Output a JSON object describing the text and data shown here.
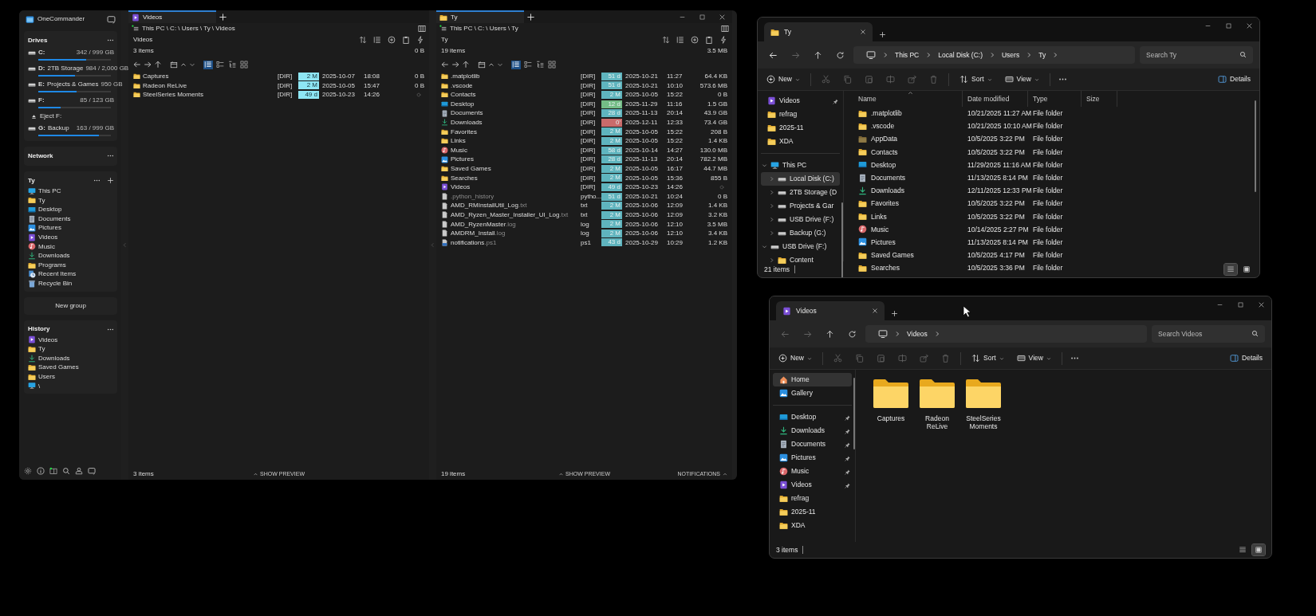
{
  "onecommander": {
    "title": "OneCommander",
    "drives": {
      "heading": "Drives",
      "items": [
        {
          "kind": "drive",
          "letter": "C:",
          "usage": "342 / 999 GB",
          "level": 0.66
        },
        {
          "kind": "drive",
          "letter": "D:",
          "label": "2TB Storage",
          "usage": "984 / 2,000 GB",
          "level": 0.51
        },
        {
          "kind": "drive",
          "letter": "E:",
          "label": "Projects & Games",
          "usage": "950 GB",
          "level": 0.53
        },
        {
          "kind": "drive",
          "letter": "F:",
          "usage": "85 / 123 GB",
          "level": 0.31
        },
        {
          "kind": "eject",
          "label": "Eject F:"
        },
        {
          "kind": "drive",
          "letter": "G:",
          "label": "Backup",
          "usage": "163 / 999 GB",
          "level": 0.84
        }
      ]
    },
    "network": {
      "heading": "Network"
    },
    "group": {
      "heading": "Ty",
      "items": [
        {
          "kind": "pc",
          "label": "This PC"
        },
        {
          "kind": "folder",
          "label": "Ty"
        },
        {
          "kind": "desktop",
          "label": "Desktop"
        },
        {
          "kind": "documents",
          "label": "Documents"
        },
        {
          "kind": "pictures",
          "label": "Pictures"
        },
        {
          "kind": "videos",
          "label": "Videos"
        },
        {
          "kind": "music",
          "label": "Music"
        },
        {
          "kind": "downloads",
          "label": "Downloads"
        },
        {
          "kind": "folder",
          "label": "Programs"
        },
        {
          "kind": "recent",
          "label": "Recent Items"
        },
        {
          "kind": "recycle",
          "label": "Recycle Bin"
        }
      ]
    },
    "new_group": "New group",
    "history": {
      "heading": "History",
      "items": [
        {
          "kind": "videos",
          "label": "Videos"
        },
        {
          "kind": "folder",
          "label": "Ty"
        },
        {
          "kind": "downloads",
          "label": "Downloads"
        },
        {
          "kind": "folder",
          "label": "Saved Games"
        },
        {
          "kind": "folder",
          "label": "Users"
        },
        {
          "kind": "pc",
          "label": "\\"
        }
      ]
    },
    "panes": [
      {
        "tab": {
          "kind": "videos",
          "label": "Videos"
        },
        "path": "This PC  \\ C: \\ Users \\ Ty \\ Videos",
        "folder": "Videos",
        "count": "3 items",
        "total": "0 B",
        "views": [
          {
            "kind": "details",
            "selected": true
          },
          {
            "kind": "list",
            "selected": false
          },
          {
            "kind": "tree",
            "selected": false
          },
          {
            "kind": "grid",
            "selected": false
          }
        ],
        "rows": [
          {
            "kind": "folder",
            "name": "Captures",
            "type": "[DIR]",
            "age": "2 M",
            "color": "#8ee6f4",
            "date": "2025-10-07",
            "time": "18:08",
            "size": "0 B"
          },
          {
            "kind": "folder",
            "name": "Radeon ReLive",
            "type": "[DIR]",
            "age": "2 M",
            "color": "#8ee6f4",
            "date": "2025-10-05",
            "time": "15:47",
            "size": "0 B"
          },
          {
            "kind": "folder",
            "name": "SteelSeries Moments",
            "type": "[DIR]",
            "age": "49 d",
            "color": "#8ee6f4",
            "date": "2025-10-23",
            "time": "14:26",
            "size_pending": true
          }
        ],
        "status": "3 items",
        "preview": "SHOW PREVIEW"
      },
      {
        "tab": {
          "kind": "folder",
          "label": "Ty"
        },
        "window_controls": true,
        "path": "This PC  \\ C: \\ Users \\ Ty",
        "folder": "Ty",
        "count": "19 items",
        "total": "3.5 MB",
        "views": [
          {
            "kind": "details",
            "selected": true
          },
          {
            "kind": "list",
            "selected": false
          },
          {
            "kind": "tree",
            "selected": false
          },
          {
            "kind": "grid",
            "selected": false
          }
        ],
        "rows": [
          {
            "kind": "folder",
            "name": ".matplotlib",
            "type": "[DIR]",
            "age": "51 d",
            "color": "#5fb4be",
            "date": "2025-10-21",
            "time": "11:27",
            "size": "64.4 KB"
          },
          {
            "kind": "folder",
            "name": ".vscode",
            "type": "[DIR]",
            "age": "51 d",
            "color": "#5fb4be",
            "date": "2025-10-21",
            "time": "10:10",
            "size": "573.6 MB"
          },
          {
            "kind": "folder",
            "name": "Contacts",
            "type": "[DIR]",
            "age": "2 M",
            "color": "#5fb4be",
            "date": "2025-10-05",
            "time": "15:22",
            "size": "0 B"
          },
          {
            "kind": "desktop",
            "name": "Desktop",
            "type": "[DIR]",
            "age": "12 d",
            "color": "#74bd86",
            "date": "2025-11-29",
            "time": "11:16",
            "size": "1.5 GB"
          },
          {
            "kind": "documents",
            "name": "Documents",
            "type": "[DIR]",
            "age": "28 d",
            "color": "#5fb4be",
            "date": "2025-11-13",
            "time": "20:14",
            "size": "43.9 GB"
          },
          {
            "kind": "downloads",
            "name": "Downloads",
            "type": "[DIR]",
            "age": "0'",
            "color": "#c96b6b",
            "date": "2025-12-11",
            "time": "12:33",
            "size": "73.4 GB"
          },
          {
            "kind": "folder",
            "name": "Favorites",
            "type": "[DIR]",
            "age": "2 M",
            "color": "#5fb4be",
            "date": "2025-10-05",
            "time": "15:22",
            "size": "208 B"
          },
          {
            "kind": "folder",
            "name": "Links",
            "type": "[DIR]",
            "age": "2 M",
            "color": "#5fb4be",
            "date": "2025-10-05",
            "time": "15:22",
            "size": "1.4 KB"
          },
          {
            "kind": "music",
            "name": "Music",
            "type": "[DIR]",
            "age": "58 d",
            "color": "#5fb4be",
            "date": "2025-10-14",
            "time": "14:27",
            "size": "130.0 MB"
          },
          {
            "kind": "pictures",
            "name": "Pictures",
            "type": "[DIR]",
            "age": "28 d",
            "color": "#5fb4be",
            "date": "2025-11-13",
            "time": "20:14",
            "size": "782.2 MB"
          },
          {
            "kind": "folder",
            "name": "Saved Games",
            "type": "[DIR]",
            "age": "2 M",
            "color": "#5fb4be",
            "date": "2025-10-05",
            "time": "16:17",
            "size": "44.7 MB"
          },
          {
            "kind": "folder",
            "name": "Searches",
            "type": "[DIR]",
            "age": "2 M",
            "color": "#5fb4be",
            "date": "2025-10-05",
            "time": "15:36",
            "size": "855 B"
          },
          {
            "kind": "videos",
            "name": "Videos",
            "type": "[DIR]",
            "age": "49 d",
            "color": "#5fb4be",
            "date": "2025-10-23",
            "time": "14:26",
            "size_pending": true
          },
          {
            "kind": "file",
            "ext": ".python_history",
            "type": "pytho...",
            "age": "51 d",
            "color": "#5fb4be",
            "date": "2025-10-21",
            "time": "10:24",
            "size": "0 B"
          },
          {
            "kind": "file",
            "name": "AMD_RMInstallUtil_Log",
            "ext": ".txt",
            "type": "txt",
            "age": "2 M",
            "color": "#5fb4be",
            "date": "2025-10-06",
            "time": "12:09",
            "size": "1.4 KB"
          },
          {
            "kind": "file",
            "name": "AMD_Ryzen_Master_Installer_UI_Log",
            "ext": ".txt",
            "type": "txt",
            "age": "2 M",
            "color": "#5fb4be",
            "date": "2025-10-06",
            "time": "12:09",
            "size": "3.2 KB"
          },
          {
            "kind": "file",
            "name": "AMD_RyzenMaster",
            "ext": ".log",
            "type": "log",
            "age": "2 M",
            "color": "#5fb4be",
            "date": "2025-10-06",
            "time": "12:10",
            "size": "3.5 MB"
          },
          {
            "kind": "file",
            "name": "AMDRM_Install",
            "ext": ".log",
            "type": "log",
            "age": "2 M",
            "color": "#5fb4be",
            "date": "2025-10-06",
            "time": "12:10",
            "size": "3.4 KB"
          },
          {
            "kind": "script",
            "name": "notifications",
            "ext": ".ps1",
            "type": "ps1",
            "age": "43 d",
            "color": "#5fb4be",
            "date": "2025-10-29",
            "time": "10:29",
            "size": "1.2 KB"
          }
        ],
        "status": "19 items",
        "preview": "SHOW PREVIEW",
        "notifications": "NOTIFICATIONS"
      }
    ]
  },
  "explorers": [
    {
      "tab": {
        "kind": "folder",
        "label": "Ty"
      },
      "back_enabled": true,
      "forward_enabled": false,
      "address": [
        "This PC",
        "Local Disk (C:)",
        "Users",
        "Ty"
      ],
      "search": {
        "placeholder": "Search Ty"
      },
      "toolbar": {
        "new": "New",
        "sort": "Sort",
        "view": "View",
        "details": "Details"
      },
      "sections": [
        {
          "items": [
            {
              "kind": "videos",
              "label": "Videos",
              "pinned": true,
              "selected": false
            },
            {
              "kind": "folder",
              "label": "refrag",
              "pinned": false,
              "selected": false
            },
            {
              "kind": "folder",
              "label": "2025-11",
              "pinned": false,
              "selected": false
            },
            {
              "kind": "folder",
              "label": "XDA",
              "pinned": false,
              "selected": false
            }
          ]
        },
        {
          "items": [
            {
              "kind": "pc",
              "label": "This PC",
              "expanded": true,
              "selected": false,
              "children": [
                {
                  "kind": "drive",
                  "label": "Local Disk (C:)",
                  "expanded": false,
                  "selected": true
                },
                {
                  "kind": "drive",
                  "label": "2TB Storage (D",
                  "expanded": false,
                  "selected": false
                },
                {
                  "kind": "drive",
                  "label": "Projects & Gar",
                  "expanded": false,
                  "selected": false
                },
                {
                  "kind": "drive",
                  "label": "USB Drive (F:)",
                  "expanded": false,
                  "selected": false
                },
                {
                  "kind": "drive",
                  "label": "Backup (G:)",
                  "expanded": false,
                  "selected": false
                }
              ]
            },
            {
              "kind": "drive",
              "label": "USB Drive (F:)",
              "expanded": true,
              "selected": false,
              "children": [
                {
                  "kind": "folder",
                  "label": "Content",
                  "expanded": false,
                  "selected": false
                }
              ]
            }
          ]
        }
      ],
      "view": {
        "kind": "details",
        "columns": [
          "Name",
          "Date modified",
          "Type",
          "Size"
        ],
        "rows": [
          {
            "kind": "folder",
            "name": ".matplotlib",
            "date": "10/21/2025 11:27 AM",
            "type": "File folder"
          },
          {
            "kind": "folder",
            "name": ".vscode",
            "date": "10/21/2025 10:10 AM",
            "type": "File folder"
          },
          {
            "kind": "folder_hidden",
            "name": "AppData",
            "date": "10/5/2025 3:22 PM",
            "type": "File folder"
          },
          {
            "kind": "folder",
            "name": "Contacts",
            "date": "10/5/2025 3:22 PM",
            "type": "File folder"
          },
          {
            "kind": "desktop",
            "name": "Desktop",
            "date": "11/29/2025 11:16 AM",
            "type": "File folder"
          },
          {
            "kind": "documents",
            "name": "Documents",
            "date": "11/13/2025 8:14 PM",
            "type": "File folder"
          },
          {
            "kind": "downloads",
            "name": "Downloads",
            "date": "12/11/2025 12:33 PM",
            "type": "File folder"
          },
          {
            "kind": "folder",
            "name": "Favorites",
            "date": "10/5/2025 3:22 PM",
            "type": "File folder"
          },
          {
            "kind": "folder",
            "name": "Links",
            "date": "10/5/2025 3:22 PM",
            "type": "File folder"
          },
          {
            "kind": "music",
            "name": "Music",
            "date": "10/14/2025 2:27 PM",
            "type": "File folder"
          },
          {
            "kind": "pictures",
            "name": "Pictures",
            "date": "11/13/2025 8:14 PM",
            "type": "File folder"
          },
          {
            "kind": "folder",
            "name": "Saved Games",
            "date": "10/5/2025 4:17 PM",
            "type": "File folder"
          },
          {
            "kind": "folder",
            "name": "Searches",
            "date": "10/5/2025 3:36 PM",
            "type": "File folder"
          }
        ]
      },
      "status": "21 items",
      "view_toggle": [
        {
          "kind": "details",
          "selected": true
        },
        {
          "kind": "tiles",
          "selected": false
        }
      ]
    },
    {
      "tab": {
        "kind": "videos",
        "label": "Videos"
      },
      "back_enabled": false,
      "forward_enabled": false,
      "address": [
        "Videos"
      ],
      "search": {
        "placeholder": "Search Videos"
      },
      "toolbar": {
        "new": "New",
        "sort": "Sort",
        "view": "View",
        "details": "Details"
      },
      "sections": [
        {
          "items": [
            {
              "kind": "home",
              "label": "Home",
              "pinned": false,
              "selected": true
            },
            {
              "kind": "pictures",
              "label": "Gallery",
              "pinned": false,
              "selected": false
            }
          ]
        },
        {
          "items": [
            {
              "kind": "desktop",
              "label": "Desktop",
              "pinned": true,
              "selected": false
            },
            {
              "kind": "downloads",
              "label": "Downloads",
              "pinned": true,
              "selected": false
            },
            {
              "kind": "documents",
              "label": "Documents",
              "pinned": true,
              "selected": false
            },
            {
              "kind": "pictures",
              "label": "Pictures",
              "pinned": true,
              "selected": false
            },
            {
              "kind": "music",
              "label": "Music",
              "pinned": true,
              "selected": false
            },
            {
              "kind": "videos",
              "label": "Videos",
              "pinned": true,
              "selected": false
            },
            {
              "kind": "folder",
              "label": "refrag",
              "pinned": false,
              "selected": false
            },
            {
              "kind": "folder",
              "label": "2025-11",
              "pinned": false,
              "selected": false
            },
            {
              "kind": "folder",
              "label": "XDA",
              "pinned": false,
              "selected": false
            }
          ]
        }
      ],
      "view": {
        "kind": "icons",
        "items": [
          {
            "label": "Captures"
          },
          {
            "label": "Radeon ReLive"
          },
          {
            "label": "SteelSeries Moments"
          }
        ]
      },
      "status": "3 items",
      "view_toggle": [
        {
          "kind": "details",
          "selected": false
        },
        {
          "kind": "tiles",
          "selected": true
        }
      ]
    }
  ]
}
